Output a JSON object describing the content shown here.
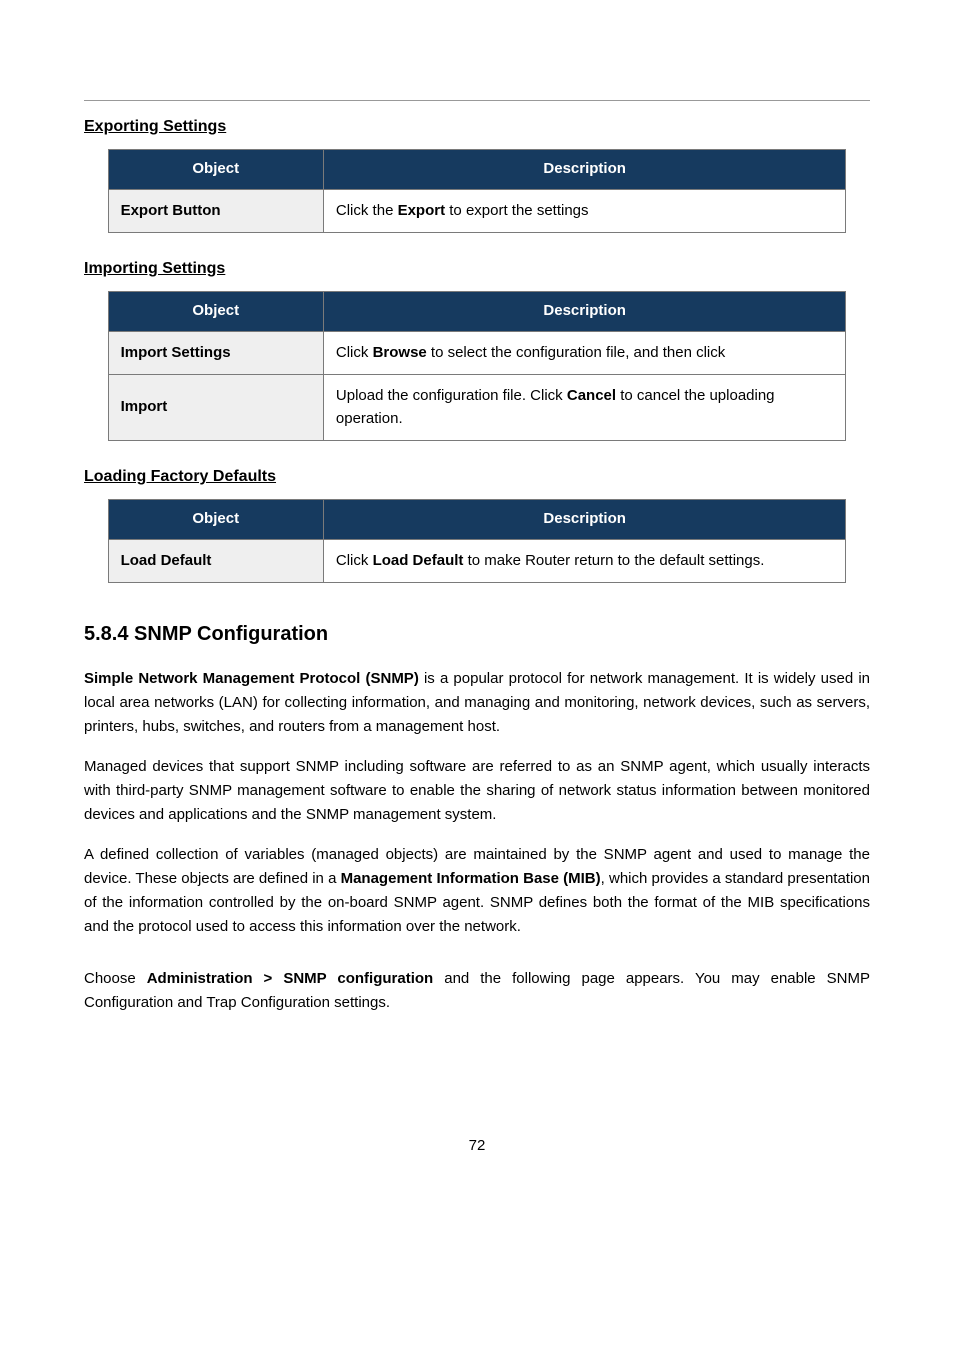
{
  "sections": {
    "exporting": {
      "heading": "Exporting Settings",
      "header_object": "Object",
      "header_desc": "Description",
      "row1": {
        "object": "Export Button",
        "desc_pre": "Click the ",
        "desc_bold": "Export",
        "desc_post": " to export the settings"
      }
    },
    "importing": {
      "heading": "Importing Settings",
      "header_object": "Object",
      "header_desc": "Description",
      "row1": {
        "object": "Import Settings",
        "desc_pre": "Click ",
        "desc_bold": "Browse",
        "desc_post": " to select the configuration file, and then click"
      },
      "row2": {
        "object": "Import",
        "desc_pre": "Upload the configuration file. Click ",
        "desc_bold": "Cancel",
        "desc_post": " to cancel the uploading operation."
      }
    },
    "loading": {
      "heading": "Loading Factory Defaults",
      "header_object": "Object",
      "header_desc": "Description",
      "row1": {
        "object": "Load Default",
        "desc_pre": "Click ",
        "desc_bold": "Load Default",
        "desc_post": " to make Router return to the default settings."
      }
    },
    "snmp": {
      "heading": "5.8.4 SNMP Configuration",
      "p1_bold": "Simple Network Management Protocol (SNMP)",
      "p1_rest": " is a popular protocol for network management. It is widely used in local area networks (LAN) for collecting information, and managing and monitoring, network devices, such as servers, printers, hubs, switches, and routers from a management host.",
      "p2": "Managed devices that support SNMP including software are referred to as an SNMP agent, which usually interacts with third-party SNMP management software to enable the sharing of network status information between monitored devices and applications and the SNMP management system.",
      "p3_pre": "A defined collection of variables (managed objects) are maintained by the SNMP agent and used to manage the device. These objects are defined in a ",
      "p3_bold": "Management Information Base (MIB)",
      "p3_post": ", which provides a standard presentation of the information controlled by the on-board SNMP agent. SNMP defines both the format of the MIB specifications and the protocol used to access this information over the network.",
      "p4_pre": "Choose ",
      "p4_bold": "Administration > SNMP configuration",
      "p4_post": " and the following page appears. You may enable SNMP Configuration and Trap Configuration settings."
    }
  },
  "page_number": "72"
}
